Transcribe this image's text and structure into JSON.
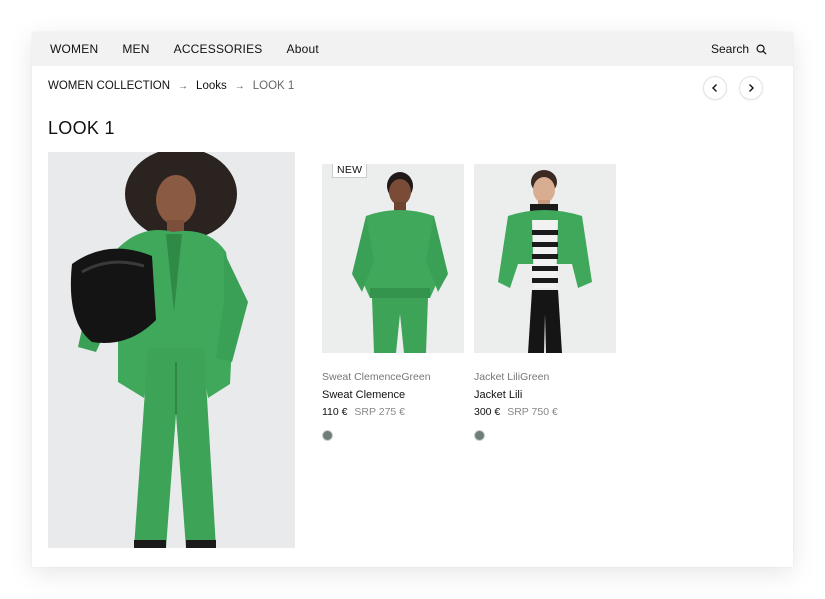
{
  "nav": {
    "items": [
      "WOMEN",
      "MEN",
      "ACCESSORIES",
      "About"
    ],
    "search_label": "Search"
  },
  "breadcrumb": {
    "items": [
      "WOMEN COLLECTION",
      "Looks",
      "LOOK 1"
    ],
    "separator": "→"
  },
  "page_title": "LOOK 1",
  "products": [
    {
      "badge": "NEW",
      "subtitle": "Sweat ClemenceGreen",
      "name": "Sweat Clemence",
      "price": "110 €",
      "srp": "SRP 275 €",
      "swatch_color": "#6f7f78"
    },
    {
      "badge": "",
      "subtitle": "Jacket LiliGreen",
      "name": "Jacket Lili",
      "price": "300 €",
      "srp": "SRP 750 €",
      "swatch_color": "#6f7f78"
    }
  ],
  "colors": {
    "garment_green": "#3fa85a",
    "nav_background": "#f2f2f2"
  }
}
